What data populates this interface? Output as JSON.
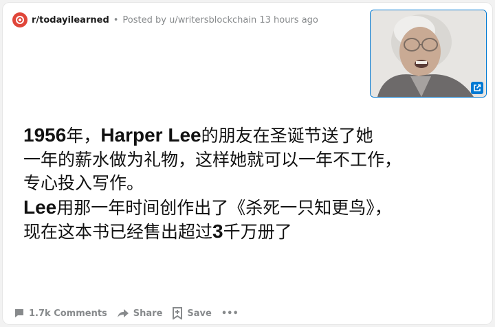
{
  "header": {
    "subreddit": "r/todayilearned",
    "separator": "•",
    "posted_by": "Posted by u/writersblockchain 13 hours ago"
  },
  "post": {
    "lines": [
      [
        "1956",
        "年，",
        "Harper Lee",
        "的朋友在圣诞节送了她"
      ],
      [
        "一年的薪水做为礼物，这样她就可以一年不工作，"
      ],
      [
        "专心投入写作。"
      ],
      [
        "Lee",
        "用那一年时间创作出了《杀死一只知更鸟》，"
      ],
      [
        "现在这本书已经售出超过",
        "3",
        "千万册了"
      ]
    ]
  },
  "actions": {
    "comments": "1.7k Comments",
    "share": "Share",
    "save": "Save",
    "more": "•••"
  },
  "icons": {
    "subreddit": "subreddit-icon",
    "external": "external-link-icon",
    "comments": "comment-icon",
    "share": "share-arrow-icon",
    "save": "save-icon",
    "more": "more-icon"
  },
  "colors": {
    "subreddit_icon": "#e0463a",
    "link_blue": "#0079d3",
    "meta_gray": "#878a8c",
    "text": "#111111"
  }
}
